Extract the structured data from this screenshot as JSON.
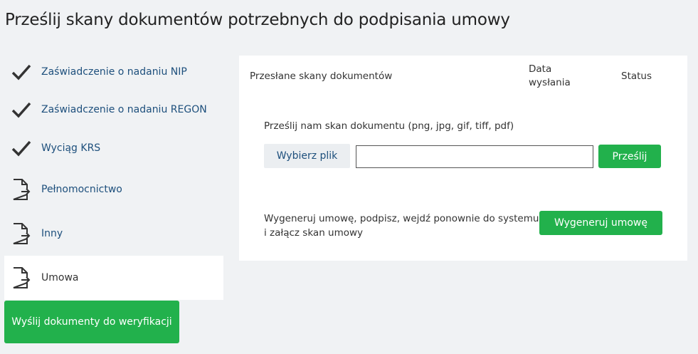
{
  "page": {
    "title": "Prześlij skany dokumentów potrzebnych do podpisania umowy"
  },
  "documents": [
    {
      "label": "Zaświadczenie o nadaniu NIP",
      "icon": "checkmark-icon",
      "state": "done"
    },
    {
      "label": "Zaświadczenie o nadaniu REGON",
      "icon": "checkmark-icon",
      "state": "done"
    },
    {
      "label": "Wyciąg KRS",
      "icon": "checkmark-icon",
      "state": "done"
    },
    {
      "label": "Pełnomocnictwo",
      "icon": "document-upload-icon",
      "state": "pending"
    },
    {
      "label": "Inny",
      "icon": "document-upload-icon",
      "state": "pending"
    },
    {
      "label": "Umowa",
      "icon": "document-upload-icon",
      "state": "active"
    }
  ],
  "send_button_label": "Wyślij dokumenty do weryfikacji",
  "panel": {
    "table_headers": {
      "name": "Przesłane skany dokumentów",
      "date": "Data wysłania",
      "status": "Status"
    },
    "upload": {
      "label": "Prześlij nam skan dokumentu (png, jpg, gif, tiff, pdf)",
      "choose_label": "Wybierz plik",
      "file_value": "",
      "submit_label": "Prześlij"
    },
    "generate": {
      "text": "Wygeneruj umowę, podpisz, wejdź ponownie do systemu i załącz skan umowy",
      "button_label": "Wygeneruj umowę"
    }
  },
  "colors": {
    "background": "#f0f2f4",
    "accent_green": "#22b14c",
    "link_blue": "#1d4f7c"
  }
}
